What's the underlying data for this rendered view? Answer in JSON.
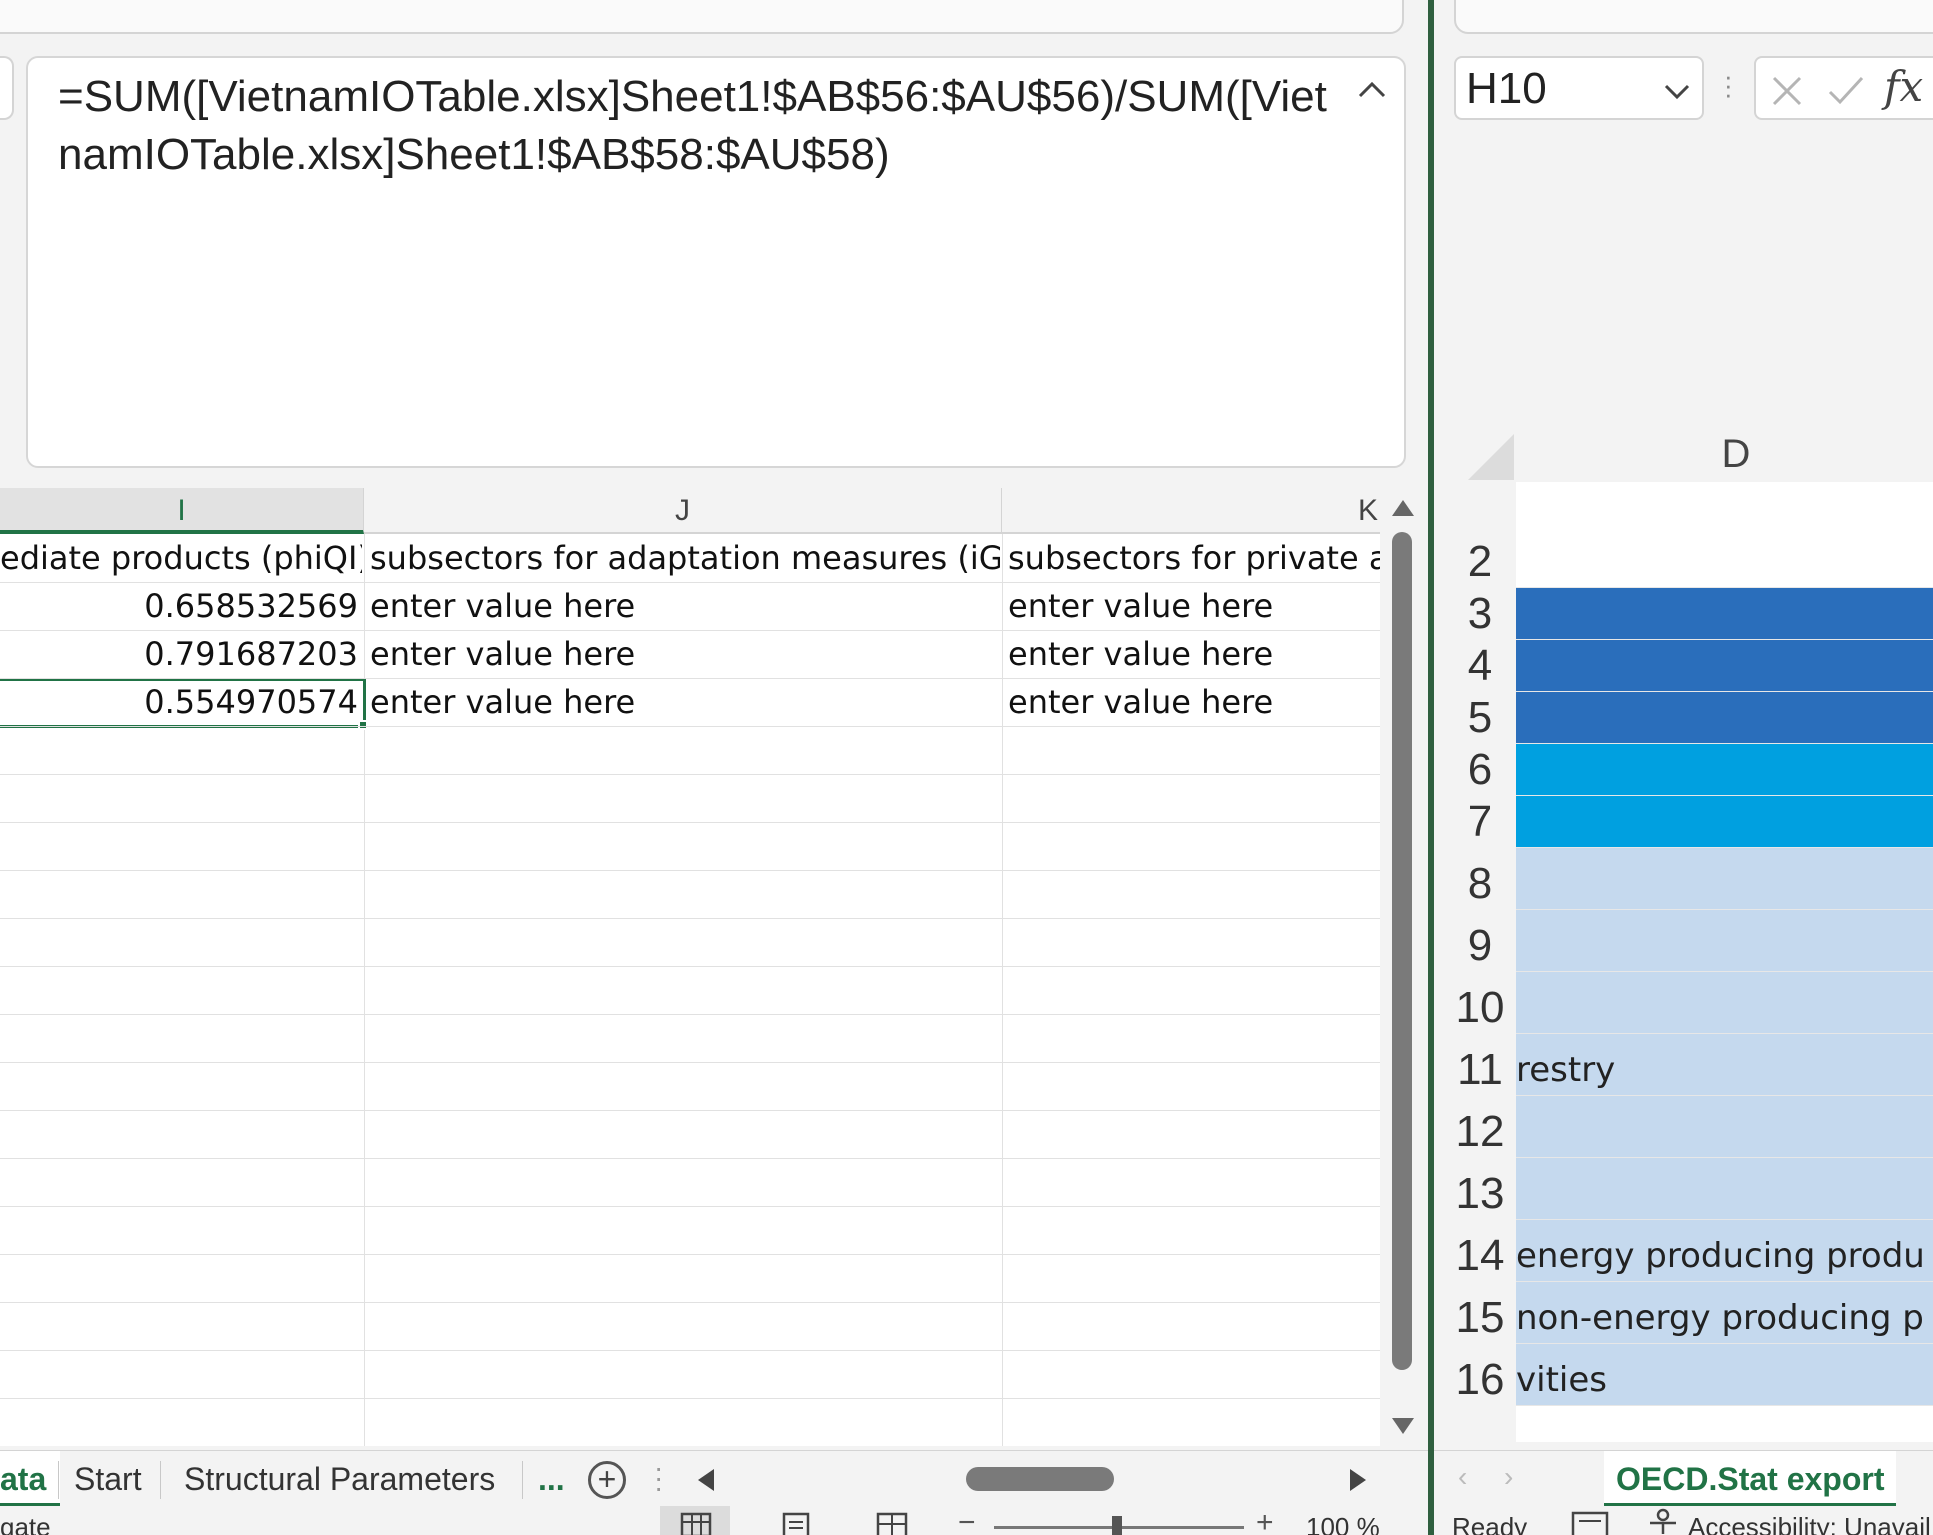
{
  "left_window": {
    "formula": "=SUM([VietnamIOTable.xlsx]Sheet1!$AB$56:$AU$56)/SUM([VietnamIOTable.xlsx]Sheet1!$AB$58:$AU$58)",
    "columns": [
      {
        "letter": "I",
        "selected": true
      },
      {
        "letter": "J",
        "selected": false
      },
      {
        "letter": "K",
        "selected": false
      }
    ],
    "header_row": [
      "ediate products (phiQI)",
      "subsectors for adaptation measures (iGA)",
      "subsectors for private ad"
    ],
    "data_rows": [
      [
        "0.658532569",
        "enter value here",
        "enter value here"
      ],
      [
        "0.791687203",
        "enter value here",
        "enter value here"
      ],
      [
        "0.554970574",
        "enter value here",
        "enter value here"
      ]
    ],
    "tabs": [
      {
        "label": "ata",
        "active": true
      },
      {
        "label": "Start",
        "active": false
      },
      {
        "label": "Structural Parameters",
        "active": false
      }
    ],
    "more_tabs_label": "...",
    "add_sheet_label": "+",
    "status_text": "gate",
    "zoom_label": "100 %"
  },
  "right_window": {
    "namebox": "H10",
    "fx_label": "fx",
    "column_letter": "D",
    "rows": [
      {
        "num": "2",
        "text": "",
        "color": "#ffffff"
      },
      {
        "num": "3",
        "text": "",
        "color": "#2a6ebb"
      },
      {
        "num": "4",
        "text": "",
        "color": "#2a6ebb"
      },
      {
        "num": "5",
        "text": "",
        "color": "#2a6ebb"
      },
      {
        "num": "6",
        "text": "",
        "color": "#00a0e0"
      },
      {
        "num": "7",
        "text": "",
        "color": "#00a0e0"
      },
      {
        "num": "8",
        "text": "",
        "color": "#c5d9ee"
      },
      {
        "num": "9",
        "text": "",
        "color": "#c5d9ee"
      },
      {
        "num": "10",
        "text": "",
        "color": "#c5d9ee"
      },
      {
        "num": "11",
        "text": "restry",
        "color": "#c5d9ee"
      },
      {
        "num": "12",
        "text": "",
        "color": "#c5d9ee"
      },
      {
        "num": "13",
        "text": "",
        "color": "#c5d9ee"
      },
      {
        "num": "14",
        "text": "energy producing produ",
        "color": "#c5d9ee"
      },
      {
        "num": "15",
        "text": "non-energy producing p",
        "color": "#c5d9ee"
      },
      {
        "num": "16",
        "text": "vities",
        "color": "#c5d9ee"
      }
    ],
    "tab_label": "OECD.Stat export",
    "status_ready": "Ready",
    "status_accessibility": "Accessibility: Unavail"
  },
  "colors": {
    "excel_green": "#217346",
    "divider_green": "#2f5f3f",
    "scroll_thumb": "#7a7a7a"
  }
}
